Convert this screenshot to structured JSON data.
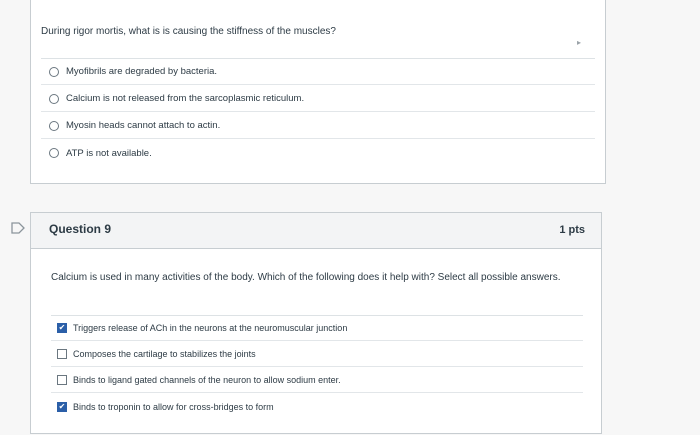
{
  "prev_question": {
    "text": "During rigor mortis, what is is causing the stiffness of the muscles?",
    "options": [
      {
        "label": "Myofibrils are degraded by bacteria."
      },
      {
        "label": "Calcium is not released from the sarcoplasmic reticulum."
      },
      {
        "label": "Myosin heads cannot attach to actin."
      },
      {
        "label": "ATP is not available."
      }
    ]
  },
  "question9": {
    "title": "Question 9",
    "points": "1 pts",
    "text": "Calcium is used in many activities of the body.  Which of the following does it help with? Select all possible answers.",
    "options": [
      {
        "label": "Triggers release of ACh in the neurons at the neuromuscular junction",
        "checked": true
      },
      {
        "label": "Composes the cartilage to stabilizes the joints",
        "checked": false
      },
      {
        "label": "Binds to ligand gated channels of the neuron to allow sodium enter.",
        "checked": false
      },
      {
        "label": "Binds to troponin to allow for cross-bridges to form",
        "checked": true
      }
    ]
  },
  "marker_icon": "question-marker-icon",
  "colors": {
    "checkbox_checked": "#2b5fa8",
    "border": "#c7cdd1"
  }
}
